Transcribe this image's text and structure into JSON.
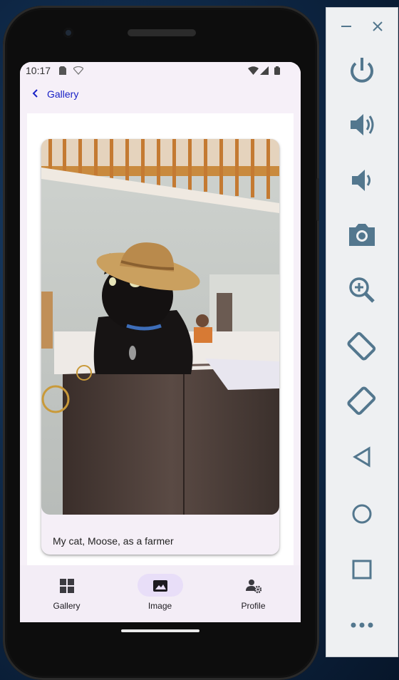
{
  "status_bar": {
    "time": "10:17",
    "icons": [
      "sim-card-icon",
      "wifi-off-icon",
      "wifi-icon",
      "cell-signal-icon",
      "battery-icon"
    ]
  },
  "app_bar": {
    "back_icon": "chevron-left-icon",
    "title": "Gallery"
  },
  "card": {
    "image_description_icon": "cat-photo",
    "caption": "My cat, Moose, as a farmer"
  },
  "bottom_nav": {
    "items": [
      {
        "label": "Gallery",
        "icon": "grid-icon",
        "active": false
      },
      {
        "label": "Image",
        "icon": "image-icon",
        "active": true
      },
      {
        "label": "Profile",
        "icon": "person-settings-icon",
        "active": false
      }
    ]
  },
  "emulator_controls": {
    "window": [
      "minimize-icon",
      "close-icon"
    ],
    "buttons": [
      "power-icon",
      "volume-up-icon",
      "volume-down-icon",
      "camera-icon",
      "zoom-in-icon",
      "rotate-left-icon",
      "rotate-right-icon",
      "back-icon",
      "home-icon",
      "overview-icon",
      "more-icon"
    ]
  },
  "colors": {
    "accent": "#1a23c6",
    "nav_active_pill": "#e8def8",
    "surface": "#f6f0f8",
    "emulator_icon": "#53778e"
  }
}
